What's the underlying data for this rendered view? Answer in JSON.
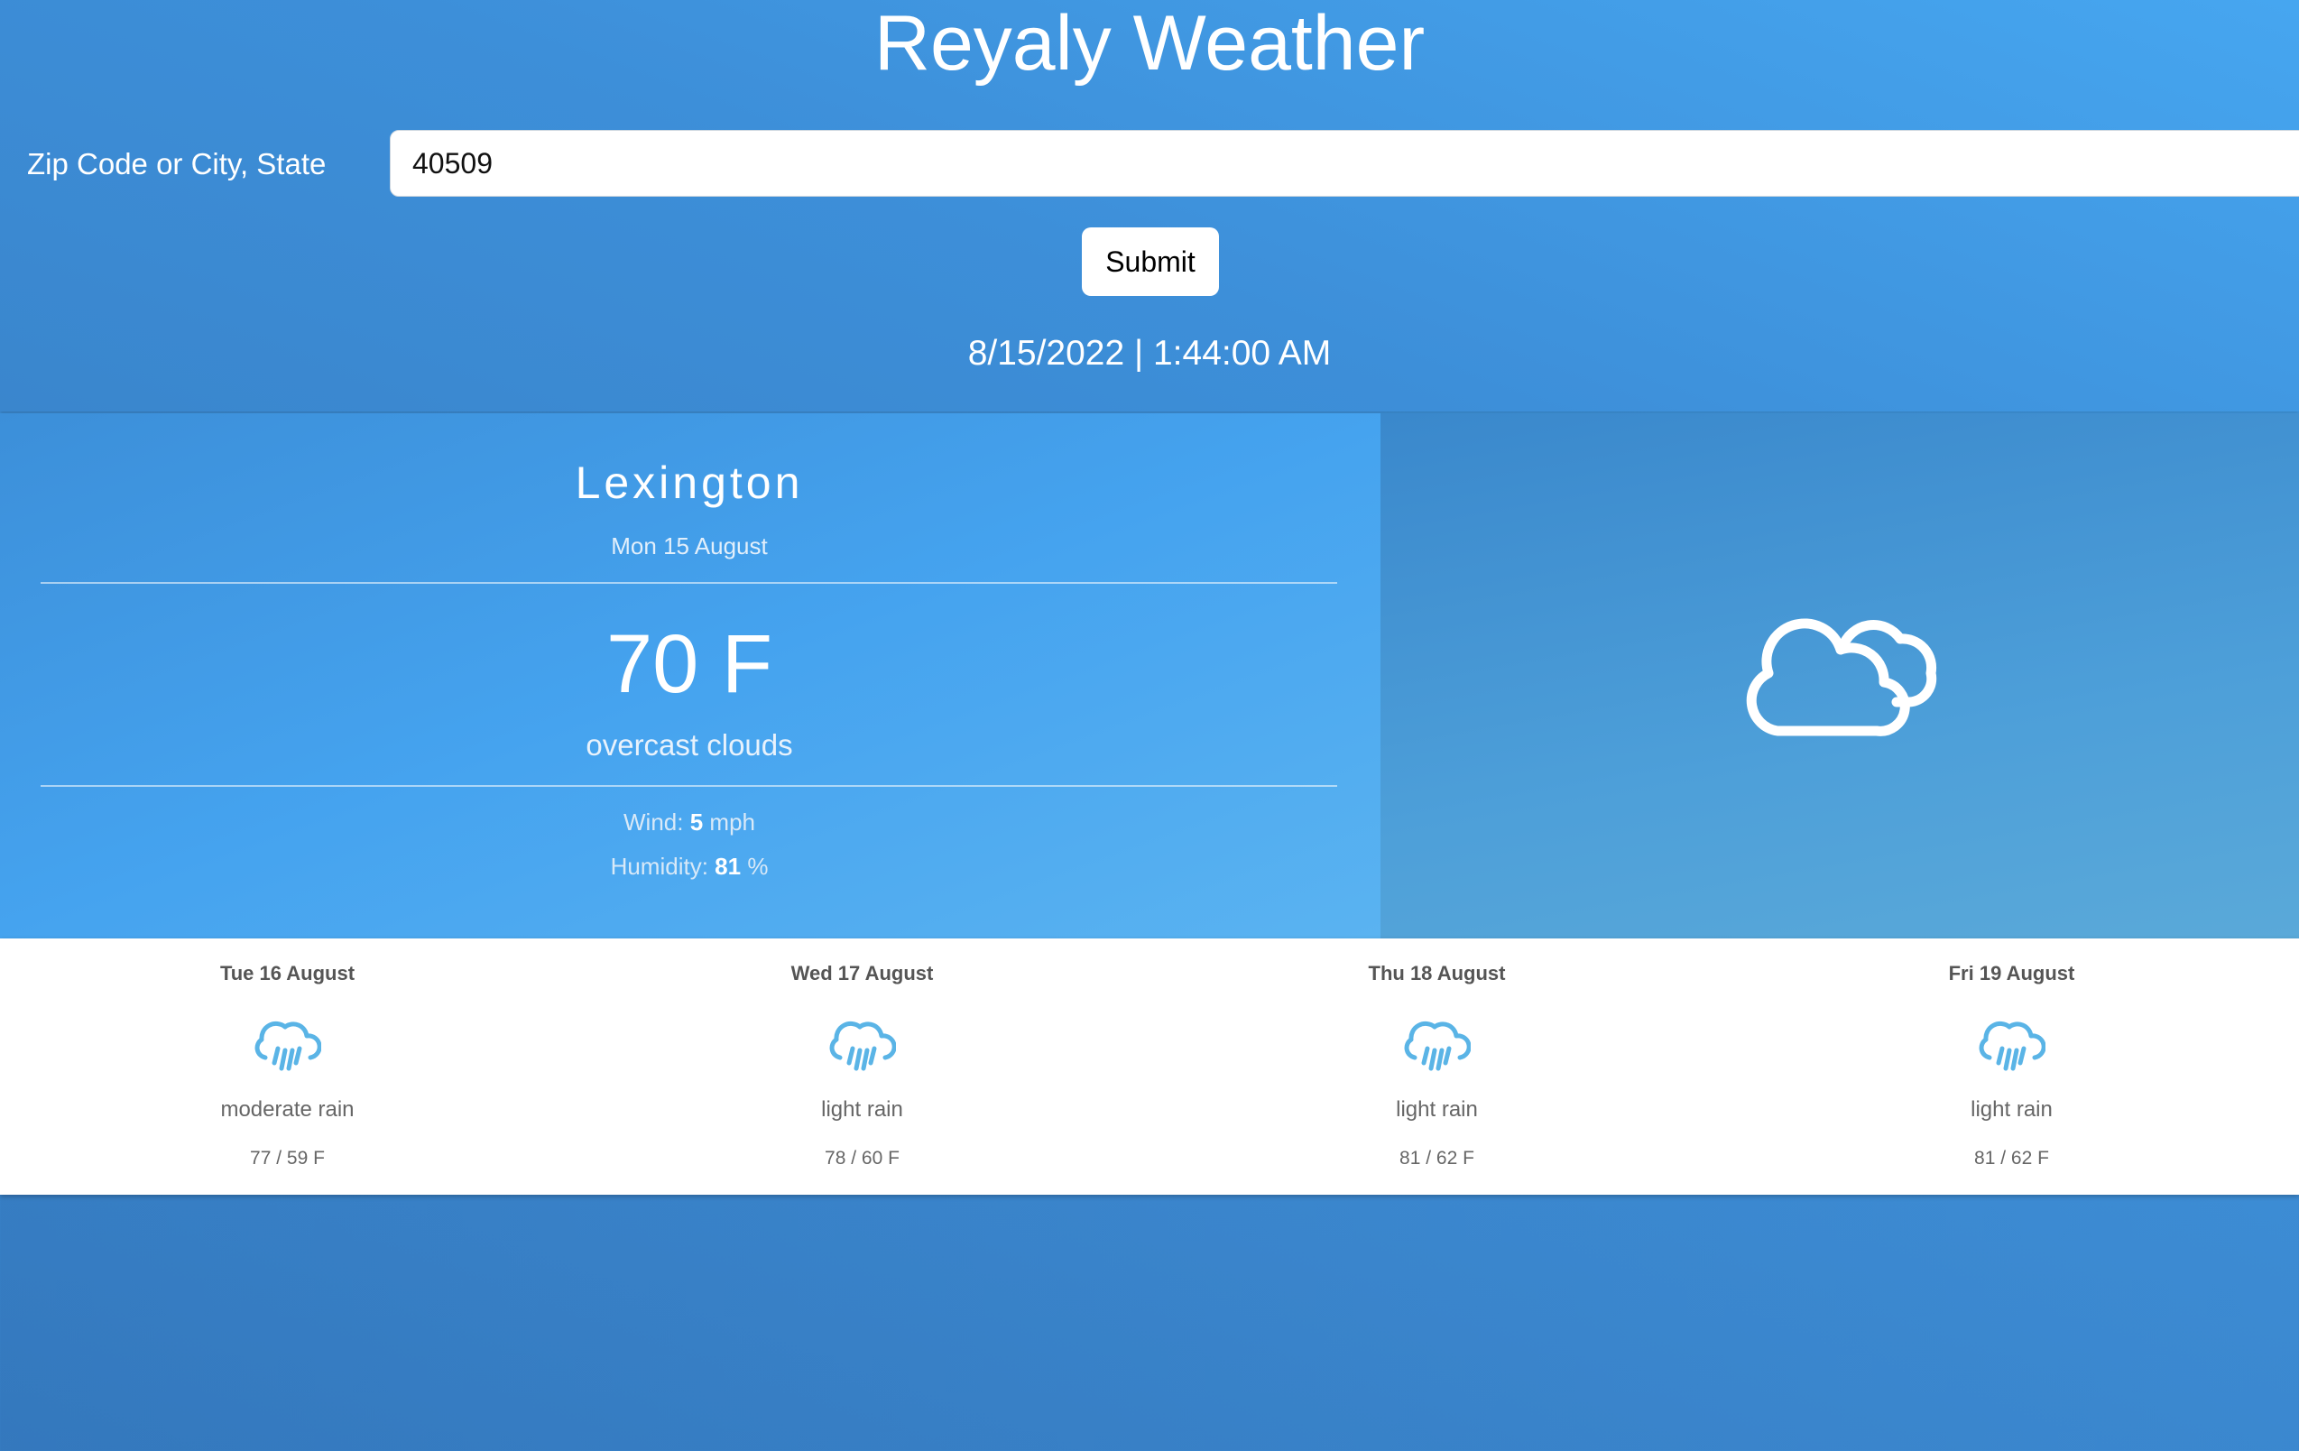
{
  "app": {
    "title": "Reyaly Weather"
  },
  "search": {
    "label": "Zip Code or City, State",
    "value": "40509",
    "submit_label": "Submit"
  },
  "datetime": "8/15/2022 | 1:44:00 AM",
  "current": {
    "city": "Lexington",
    "date": "Mon 15 August",
    "temperature": "70 F",
    "condition": "overcast clouds",
    "wind_label": "Wind:",
    "wind_value": "5",
    "wind_unit": "mph",
    "humidity_label": "Humidity:",
    "humidity_value": "81",
    "humidity_unit": "%",
    "icon": "cloud-icon"
  },
  "forecast": [
    {
      "day": "Tue 16 August",
      "icon": "rain-cloud-icon",
      "description": "moderate rain",
      "temps": "77 / 59 F"
    },
    {
      "day": "Wed 17 August",
      "icon": "rain-cloud-icon",
      "description": "light rain",
      "temps": "78 / 60 F"
    },
    {
      "day": "Thu 18 August",
      "icon": "rain-cloud-icon",
      "description": "light rain",
      "temps": "81 / 62 F"
    },
    {
      "day": "Fri 19 August",
      "icon": "rain-cloud-icon",
      "description": "light rain",
      "temps": "81 / 62 F"
    }
  ],
  "colors": {
    "background": "#3f93dc",
    "rain_icon": "#5ab4e6",
    "forecast_bg": "#ffffff"
  }
}
